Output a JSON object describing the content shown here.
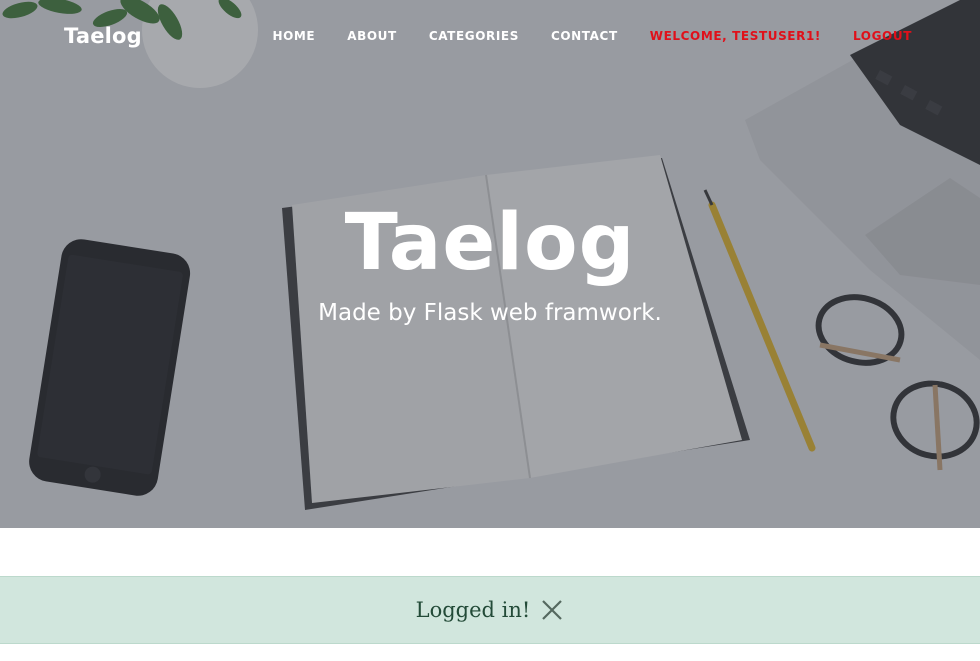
{
  "navbar": {
    "brand": "Taelog",
    "items": [
      {
        "label": "HOME"
      },
      {
        "label": "ABOUT"
      },
      {
        "label": "CATEGORIES"
      },
      {
        "label": "CONTACT"
      },
      {
        "label": "WELCOME, TESTUSER1!"
      },
      {
        "label": "LOGOUT"
      }
    ]
  },
  "hero": {
    "title": "Taelog",
    "subtitle": "Made by Flask web framwork."
  },
  "alert": {
    "message": "Logged in!",
    "close_icon": "close-icon"
  },
  "colors": {
    "accent_red": "#e0101a",
    "alert_bg": "#d1e6dd",
    "alert_text": "#234b38"
  }
}
